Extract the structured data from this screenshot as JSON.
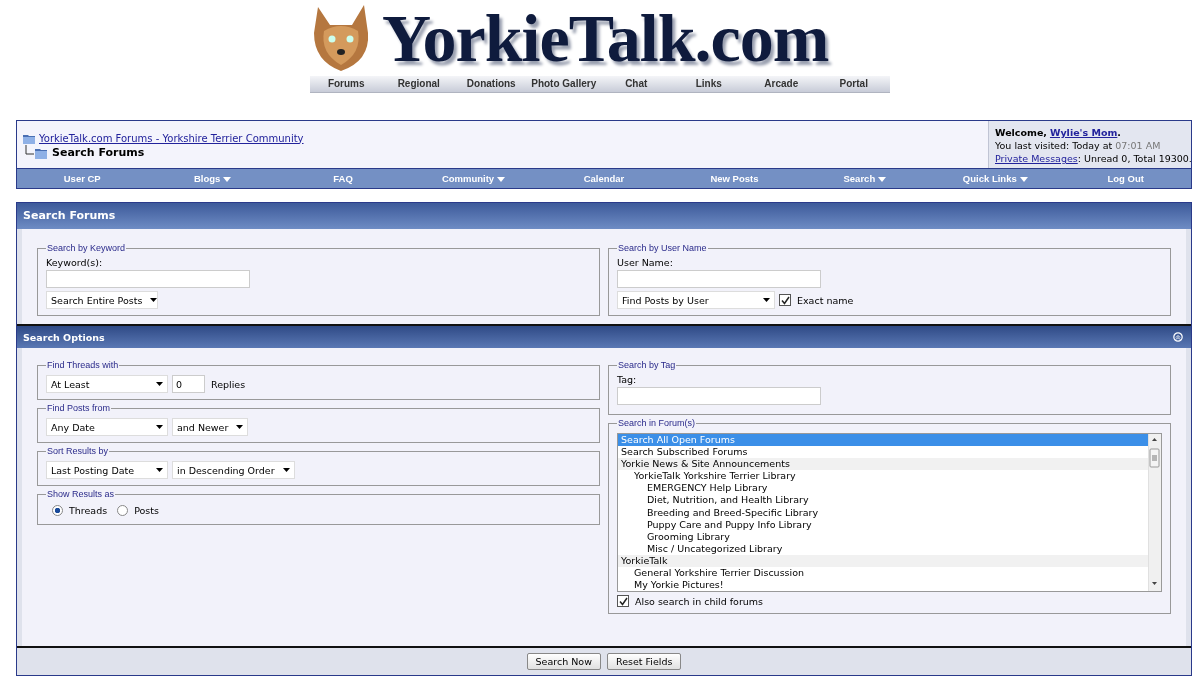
{
  "logo": {
    "text": "YorkieTalk.com"
  },
  "site_menu": [
    "Forums",
    "Regional",
    "Donations",
    "Photo Gallery",
    "Chat",
    "Links",
    "Arcade",
    "Portal"
  ],
  "breadcrumb": {
    "parent": "YorkieTalk.com Forums - Yorkshire Terrier Community",
    "current": "Search Forums"
  },
  "welcome": {
    "greeting": "Welcome,",
    "user": "Wylie's Mom",
    "after_user": ".",
    "visited_label": "You last visited: Today at",
    "visited_time": "07:01 AM",
    "pm_link": "Private Messages",
    "pm_text": ": Unread 0, Total 19300."
  },
  "navbar": [
    {
      "label": "User CP",
      "has_menu": false
    },
    {
      "label": "Blogs",
      "has_menu": true
    },
    {
      "label": "FAQ",
      "has_menu": false
    },
    {
      "label": "Community",
      "has_menu": true
    },
    {
      "label": "Calendar",
      "has_menu": false
    },
    {
      "label": "New Posts",
      "has_menu": false
    },
    {
      "label": "Search",
      "has_menu": true
    },
    {
      "label": "Quick Links",
      "has_menu": true
    },
    {
      "label": "Log Out",
      "has_menu": false
    }
  ],
  "panel_title": "Search Forums",
  "keyword": {
    "legend": "Search by Keyword",
    "label": "Keyword(s):",
    "mode": "Search Entire Posts"
  },
  "username": {
    "legend": "Search by User Name",
    "label": "User Name:",
    "mode": "Find Posts by User",
    "exact_label": "Exact name",
    "exact_checked": true
  },
  "options_title": "Search Options",
  "find_threads": {
    "legend": "Find Threads with",
    "comparison": "At Least",
    "value": "0",
    "unit": "Replies"
  },
  "find_posts": {
    "legend": "Find Posts from",
    "date": "Any Date",
    "direction": "and Newer"
  },
  "sort": {
    "legend": "Sort Results by",
    "field": "Last Posting Date",
    "order": "in Descending Order"
  },
  "show_as": {
    "legend": "Show Results as",
    "options": [
      {
        "label": "Threads",
        "selected": true
      },
      {
        "label": "Posts",
        "selected": false
      }
    ]
  },
  "tag": {
    "legend": "Search by Tag",
    "label": "Tag:"
  },
  "forums": {
    "legend": "Search in Forum(s)",
    "items": [
      {
        "label": "Search All Open Forums",
        "kind": "forum",
        "selected": true
      },
      {
        "label": "Search Subscribed Forums",
        "kind": "forum",
        "selected": false
      },
      {
        "label": "Yorkie News & Site Announcements",
        "kind": "category",
        "selected": false,
        "children": [
          {
            "label": "YorkieTalk Yorkshire Terrier Library",
            "kind": "forum",
            "selected": false,
            "children": [
              {
                "label": "EMERGENCY Help Library",
                "kind": "forum",
                "selected": false
              },
              {
                "label": "Diet, Nutrition, and Health Library",
                "kind": "forum",
                "selected": false
              },
              {
                "label": "Breeding and Breed-Specific Library",
                "kind": "forum",
                "selected": false
              },
              {
                "label": "Puppy Care and Puppy Info Library",
                "kind": "forum",
                "selected": false
              },
              {
                "label": "Grooming Library",
                "kind": "forum",
                "selected": false
              },
              {
                "label": "Misc / Uncategorized Library",
                "kind": "forum",
                "selected": false
              }
            ]
          }
        ]
      },
      {
        "label": "YorkieTalk",
        "kind": "category",
        "selected": false,
        "children": [
          {
            "label": "General Yorkshire Terrier Discussion",
            "kind": "forum",
            "selected": false
          },
          {
            "label": "My Yorkie Pictures!",
            "kind": "forum",
            "selected": false
          }
        ]
      }
    ],
    "child_label": "Also search in child forums",
    "child_checked": true
  },
  "buttons": [
    "Search Now",
    "Reset Fields"
  ]
}
